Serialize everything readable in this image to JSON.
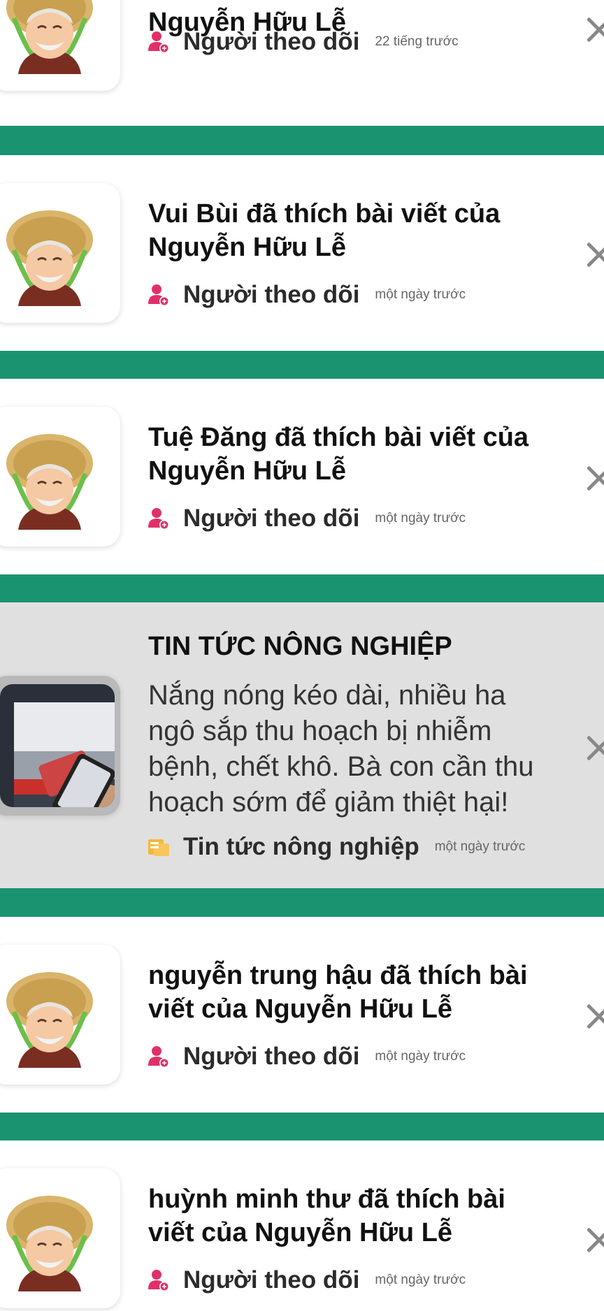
{
  "notifications": [
    {
      "title_line1": "",
      "title_line2": "Nguyễn Hữu Lễ",
      "source": "Người theo dõi",
      "time": "22 tiếng trước"
    },
    {
      "title_line1": "Vui Bùi đã thích bài viết của",
      "title_line2": "Nguyễn Hữu Lễ",
      "source": "Người theo dõi",
      "time": "một ngày trước"
    },
    {
      "title_line1": "Tuệ Đăng đã thích bài viết của",
      "title_line2": "Nguyễn Hữu Lễ",
      "source": "Người theo dõi",
      "time": "một ngày trước"
    }
  ],
  "news": {
    "category": "TIN TỨC NÔNG NGHIỆP",
    "body_lines": [
      "Nắng nóng kéo dài, nhiều ha",
      "ngô sắp thu hoạch bị nhiễm",
      "bệnh, chết khô. Bà con cần thu",
      "hoạch sớm để giảm thiệt hại!"
    ],
    "source": "Tin tức nông nghiệp",
    "time": "một ngày trước"
  },
  "notifications_after": [
    {
      "title_line1": "nguyễn trung hậu đã thích bài",
      "title_line2": "viết của Nguyễn Hữu Lễ",
      "source": "Người theo dõi",
      "time": "một ngày trước"
    },
    {
      "title_line1": "huỳnh minh thư đã thích bài",
      "title_line2": "viết của Nguyễn Hữu Lễ",
      "source": "Người theo dõi",
      "time": "một ngày trước"
    }
  ],
  "icons": {
    "follower": "user-add-icon",
    "news": "newspaper-icon",
    "close": "close-icon",
    "avatar": "farmer-avatar-icon"
  },
  "colors": {
    "separator": "#1a9470",
    "follower_icon": "#e0306a",
    "news_icon": "#f5b73b",
    "news_bg": "#e0e0e0"
  }
}
